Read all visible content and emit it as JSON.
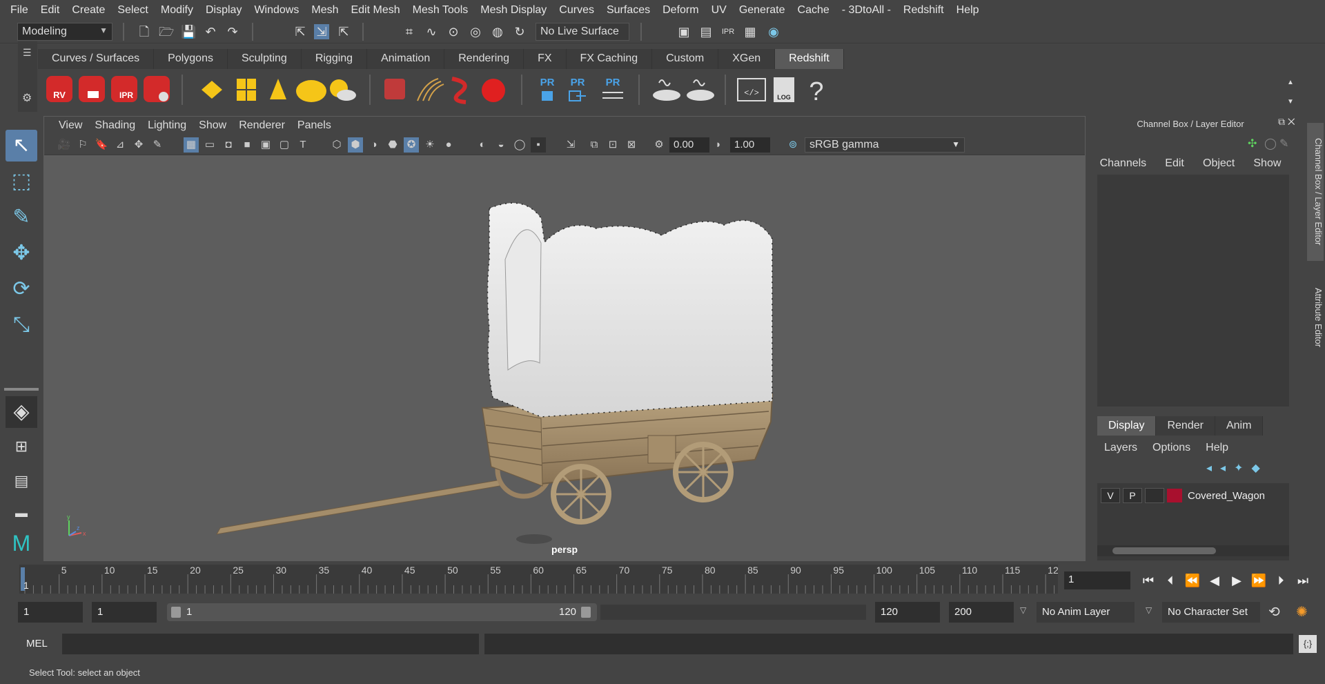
{
  "menubar": [
    "File",
    "Edit",
    "Create",
    "Select",
    "Modify",
    "Display",
    "Windows",
    "Mesh",
    "Edit Mesh",
    "Mesh Tools",
    "Mesh Display",
    "Curves",
    "Surfaces",
    "Deform",
    "UV",
    "Generate",
    "Cache",
    "- 3DtoAll -",
    "Redshift",
    "Help"
  ],
  "statusline": {
    "mode": "Modeling",
    "live_surface": "No Live Surface"
  },
  "shelf": {
    "tabs": [
      "Curves / Surfaces",
      "Polygons",
      "Sculpting",
      "Rigging",
      "Animation",
      "Rendering",
      "FX",
      "FX Caching",
      "Custom",
      "XGen",
      "Redshift"
    ],
    "active": "Redshift",
    "icon_labels": {
      "rv": "RV",
      "ipr": "IPR",
      "pr1": "PR",
      "pr2": "PR",
      "pr3": "PR",
      "log": "LOG"
    }
  },
  "viewport": {
    "menu": [
      "View",
      "Shading",
      "Lighting",
      "Show",
      "Renderer",
      "Panels"
    ],
    "exposure": "0.00",
    "gamma": "1.00",
    "color_space": "sRGB gamma",
    "camera": "persp",
    "axis": {
      "y": "y",
      "x": "x",
      "z": "z"
    }
  },
  "right_panel": {
    "title": "Channel Box / Layer Editor",
    "menu": [
      "Channels",
      "Edit",
      "Object",
      "Show"
    ],
    "layer_tabs": [
      "Display",
      "Render",
      "Anim"
    ],
    "active_layer_tab": "Display",
    "layer_menu": [
      "Layers",
      "Options",
      "Help"
    ],
    "layer": {
      "v": "V",
      "p": "P",
      "name": "Covered_Wagon",
      "color": "#a8102e"
    },
    "side_tabs": [
      "Channel Box / Layer Editor",
      "Attribute Editor"
    ]
  },
  "timeline": {
    "labels": [
      "5",
      "10",
      "15",
      "20",
      "25",
      "30",
      "35",
      "40",
      "45",
      "50",
      "55",
      "60",
      "65",
      "70",
      "75",
      "80",
      "85",
      "90",
      "95",
      "100",
      "105",
      "110",
      "115",
      "12"
    ],
    "current_marker": "1",
    "current_frame": "1"
  },
  "range": {
    "start": "1",
    "playback_start": "1",
    "slider_start": "1",
    "slider_end": "120",
    "playback_end": "120",
    "end": "200",
    "anim_layer": "No Anim Layer",
    "character_set": "No Character Set"
  },
  "command": {
    "label": "MEL"
  },
  "help": "Select Tool: select an object"
}
